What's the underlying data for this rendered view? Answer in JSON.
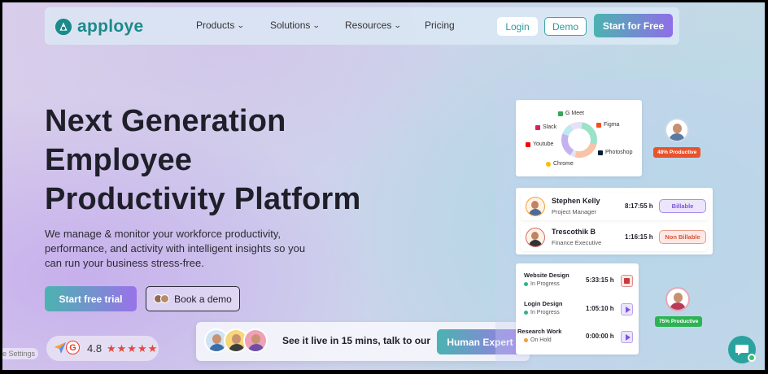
{
  "nav": {
    "logo_text": "apploye",
    "items": [
      {
        "label": "Products",
        "has_dropdown": true
      },
      {
        "label": "Solutions",
        "has_dropdown": true
      },
      {
        "label": "Resources",
        "has_dropdown": true
      },
      {
        "label": "Pricing",
        "has_dropdown": false
      }
    ],
    "login_label": "Login",
    "demo_label": "Demo",
    "start_label": "Start for Free"
  },
  "hero": {
    "title_lines": [
      "Next Generation",
      "Employee",
      "Productivity Platform"
    ],
    "description": "We manage & monitor your workforce productivity, performance, and activity with intelligent insights so you can run your business stress-free.",
    "trial_label": "Start free trial",
    "book_label": "Book a demo"
  },
  "rating": {
    "value": "4.8",
    "stars_text": "★★★★★",
    "stars_value": 4.8
  },
  "settings_label": "e Settings",
  "banner": {
    "text": "See it live in 15 mins, talk to our",
    "button_label": "Human Expert"
  },
  "chart": {
    "labels": [
      "G Meet",
      "Slack",
      "Figma",
      "Youtube",
      "Photoshop",
      "Chrome"
    ],
    "colors": [
      "#c4b2f0",
      "#9be3c8",
      "#f9c3a8",
      "#e7e1f6"
    ]
  },
  "productivity": {
    "top_badge": "48% Productive",
    "bottom_badge": "75% Productive",
    "top_badge_color": "#e8532c",
    "bottom_badge_color": "#2db354"
  },
  "employees": [
    {
      "name": "Stephen Kelly",
      "role": "Project Manager",
      "time": "8:17:55 h",
      "tag": "Billable"
    },
    {
      "name": "Trescothik B",
      "role": "Finance Executive",
      "time": "1:16:15 h",
      "tag": "Non Billable"
    }
  ],
  "tasks": [
    {
      "name": "Website Design",
      "status": "In Progress",
      "time": "5:33:15 h"
    },
    {
      "name": "Login Design",
      "status": "In Progress",
      "time": "1:05:10 h"
    },
    {
      "name": "Research Work",
      "status": "On Hold",
      "time": "0:00:00 h"
    }
  ],
  "colors": {
    "brand_teal": "#2aa39f",
    "brand_purple": "#8f6ee8"
  }
}
